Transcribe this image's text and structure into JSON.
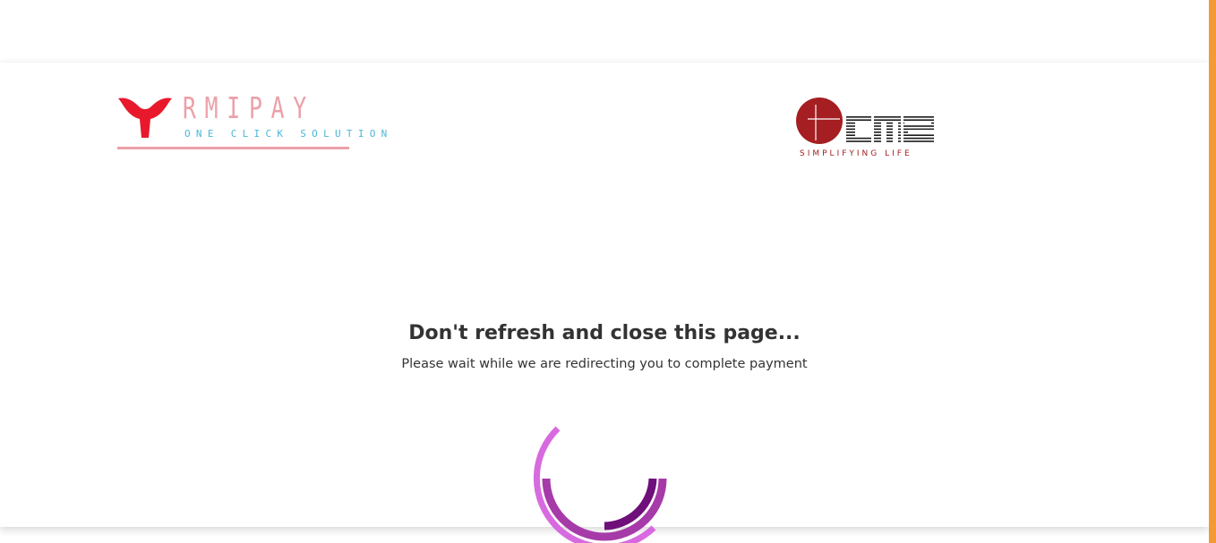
{
  "brand": {
    "name": "RMIPAY",
    "tagline": "ONE CLICK SOLUTION",
    "logo_icon": "whale-tail-icon"
  },
  "partner": {
    "name": "cms",
    "tagline": "SIMPLIFYING  LIFE",
    "logo_icon": "cms-globe-icon"
  },
  "status": {
    "heading": "Don't refresh and close this page...",
    "message": "Please wait while we are redirecting you to complete payment"
  },
  "loader": {
    "icon": "loading-spinner-icon"
  },
  "colors": {
    "brand_pink": "#e8192c",
    "brand_text_pink": "#eba0a8",
    "brand_tagline_blue": "#4ab8d8",
    "cms_red": "#a51e22",
    "cms_tagline": "#a51e22",
    "spinner_outer": "#d86ae0",
    "spinner_middle": "#a63aa8",
    "spinner_inner": "#6e0f7a",
    "accent_bar": "#f59a33",
    "text": "#333333"
  }
}
